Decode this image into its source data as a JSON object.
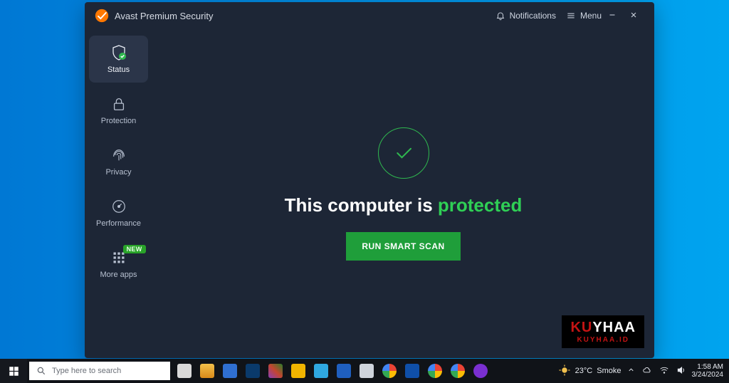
{
  "app": {
    "title": "Avast Premium Security",
    "titlebar": {
      "notifications": "Notifications",
      "menu": "Menu"
    }
  },
  "sidebar": {
    "items": [
      {
        "label": "Status",
        "icon": "shield-check-icon",
        "active": true
      },
      {
        "label": "Protection",
        "icon": "lock-icon"
      },
      {
        "label": "Privacy",
        "icon": "fingerprint-icon"
      },
      {
        "label": "Performance",
        "icon": "gauge-icon"
      },
      {
        "label": "More apps",
        "icon": "apps-grid-icon",
        "badge": "NEW"
      }
    ]
  },
  "status": {
    "heading_prefix": "This computer is ",
    "heading_accent": "protected",
    "scan_button": "RUN SMART SCAN",
    "accent_color": "#2fcf55",
    "button_color": "#1f9e3a"
  },
  "watermark": {
    "line1_red": "KU",
    "line1_white": "YHAA",
    "line2": "KUYHAA.ID"
  },
  "taskbar": {
    "search_placeholder": "Type here to search",
    "weather_temp": "23°C",
    "weather_desc": "Smoke",
    "time": "1:58 AM",
    "date": "3/24/2024"
  }
}
